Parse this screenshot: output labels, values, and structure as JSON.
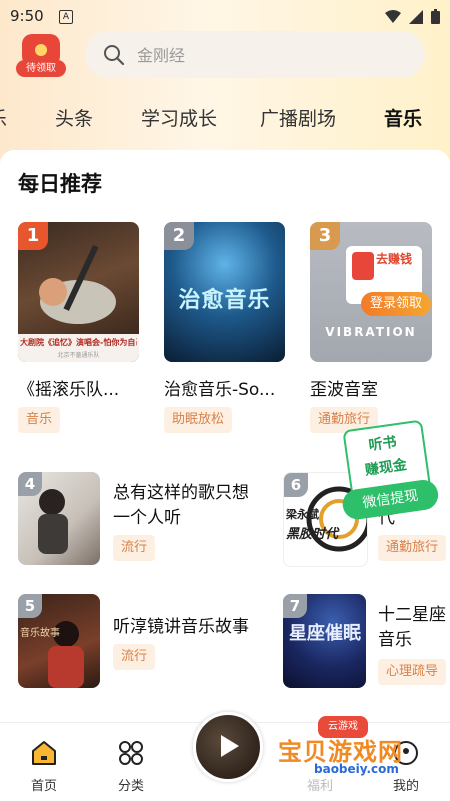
{
  "status_bar": {
    "time": "9:50",
    "notification_icon": "A"
  },
  "header": {
    "reward_label": "待领取",
    "search_placeholder": "金刚经"
  },
  "tabs": [
    {
      "label": "乐"
    },
    {
      "label": "头条"
    },
    {
      "label": "学习成长"
    },
    {
      "label": "广播剧场"
    },
    {
      "label": "音乐",
      "active": true
    }
  ],
  "section": {
    "title": "每日推荐"
  },
  "top_cards": [
    {
      "rank": "1",
      "title": "《摇滚乐队...",
      "tag": "音乐",
      "cover_text": "大剧院《追忆》演唱会-怕你为自己",
      "cover_subtext": "北京不童通乐队"
    },
    {
      "rank": "2",
      "title": "治愈音乐-So...",
      "tag": "助眠放松",
      "cover_text": "治愈音乐"
    },
    {
      "rank": "3",
      "title": "歪波音室",
      "tag": "通勤旅行",
      "cover_text": "VIBRATION",
      "promo_top": "去赚钱",
      "promo_button": "登录领取"
    }
  ],
  "list_items": [
    {
      "rank": "4",
      "title_line1": "总有这样的歌只想",
      "title_line2": "一个人听",
      "tag": "流行"
    },
    {
      "rank": "6",
      "title_line1": "代",
      "tag": "通勤旅行",
      "cover_text": "黑胶时代",
      "cover_author": "梁永斌"
    },
    {
      "rank": "5",
      "title_line1": "听淳镜讲音乐故事",
      "tag": "流行",
      "cover_text": "音乐故事"
    },
    {
      "rank": "7",
      "title_line1": "十二星座",
      "title_line2": "音乐",
      "tag": "心理疏导",
      "cover_text": "星座催眠"
    }
  ],
  "earn_badge": {
    "line1": "听书",
    "line2": "赚现金",
    "button": "微信提现"
  },
  "bottom_nav": [
    {
      "label": "首页",
      "icon": "home-icon"
    },
    {
      "label": "分类",
      "icon": "category-icon"
    },
    {
      "label": "福利",
      "icon": "player-icon"
    },
    {
      "label": "我的",
      "icon": "profile-icon"
    }
  ],
  "watermark": {
    "text": "宝贝游戏网",
    "url": "baobeiy.com",
    "badge": "云游戏"
  },
  "colors": {
    "accent": "#f0832c",
    "tag_bg": "#fdf0e3",
    "tag_text": "#d8814a",
    "green": "#2dbf6a"
  }
}
